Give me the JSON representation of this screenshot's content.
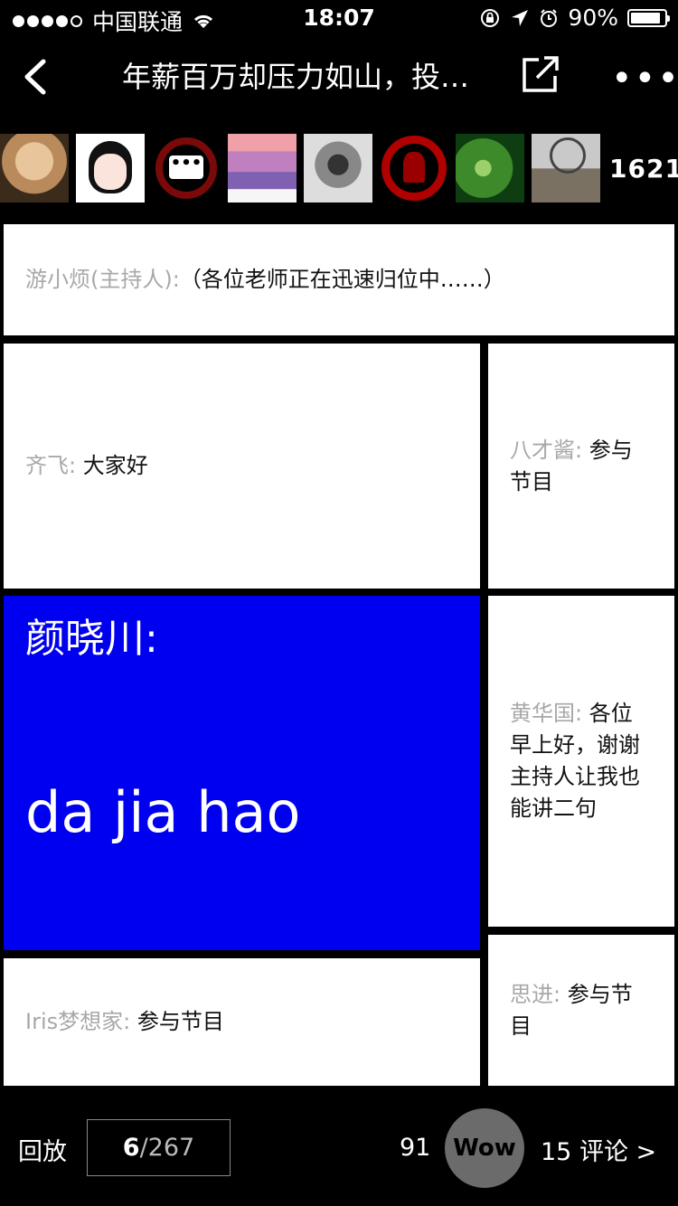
{
  "status_bar": {
    "carrier": "中国联通",
    "time": "18:07",
    "battery": "90%",
    "battery_level": 0.9,
    "signal_bars_filled": 4,
    "signal_bars_total": 5
  },
  "nav": {
    "title": "年薪百万却压力如山，投…",
    "back_icon": "chevron-left-icon",
    "share_icon": "share-icon",
    "more_icon": "more-icon"
  },
  "participants": {
    "count": "1621"
  },
  "messages": [
    {
      "name": "游小烦(主持人):",
      "text": "（各位老师正在迅速归位中……）"
    },
    {
      "name": "齐飞:",
      "text": "大家好"
    },
    {
      "name": "八才酱:",
      "text": "参与节目"
    },
    {
      "name": "颜晓川:",
      "text": "da jia hao"
    },
    {
      "name": "黄华国:",
      "text": "各位早上好，谢谢主持人让我也能讲二句"
    },
    {
      "name": "Iris梦想家:",
      "text": "参与节目"
    },
    {
      "name": "思进:",
      "text": "参与节目"
    }
  ],
  "bottom_bar": {
    "replay_label": "回放",
    "page_current": "6",
    "page_separator": "/",
    "page_total": "267",
    "like_count": "91",
    "wow_label": "Wow",
    "comments_label": "15 评论 >"
  },
  "colors": {
    "background": "#000000",
    "highlight_card": "#0000f0",
    "name_gray": "#a8a8a8",
    "wow_button": "#6b6b6b"
  }
}
